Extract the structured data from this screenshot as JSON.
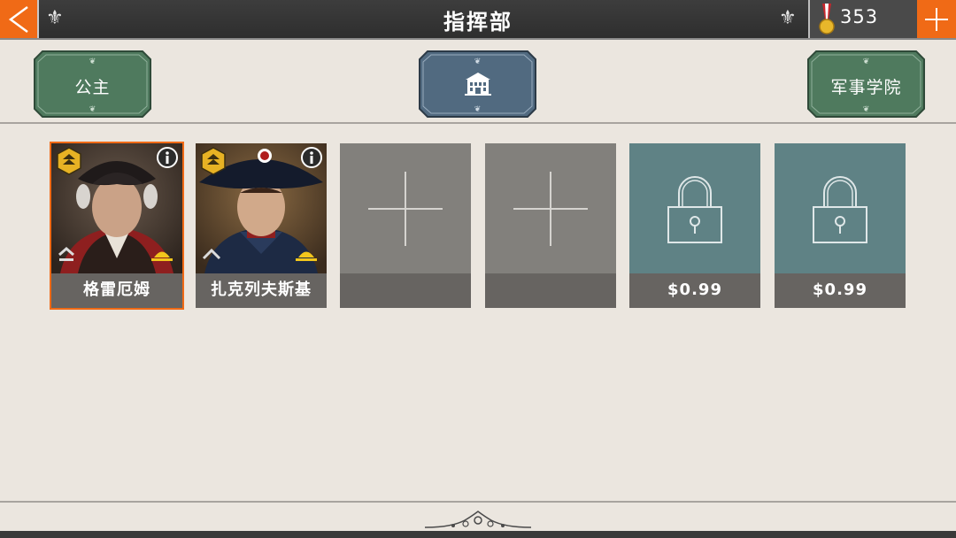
{
  "header": {
    "title": "指挥部",
    "currency_value": "353"
  },
  "tabs": [
    {
      "label": "公主"
    },
    {
      "label": "",
      "icon": "building-icon"
    },
    {
      "label": "军事学院"
    }
  ],
  "slots": [
    {
      "type": "general",
      "name": "格雷厄姆",
      "selected": true,
      "rank_icon": "rank-up-icon",
      "hat_icon": "hat-icon"
    },
    {
      "type": "general",
      "name": "扎克列夫斯基",
      "selected": false,
      "rank_icon": "rank-up-icon",
      "hat_icon": "hat-icon"
    },
    {
      "type": "empty",
      "name": ""
    },
    {
      "type": "empty",
      "name": ""
    },
    {
      "type": "locked",
      "price": "$0.99"
    },
    {
      "type": "locked",
      "price": "$0.99"
    }
  ],
  "colors": {
    "accent": "#f06a16",
    "tab_green": "#4f7a5e",
    "tab_blue": "#516a80",
    "locked_slot": "#5f8285"
  }
}
